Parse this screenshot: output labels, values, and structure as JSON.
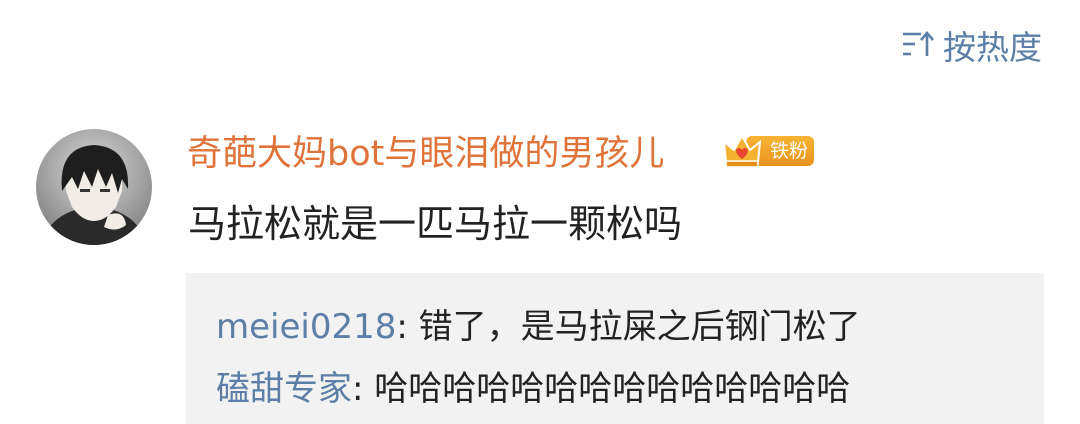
{
  "sort": {
    "label": "按热度",
    "icon": "sort-icon",
    "color": "#5b7fa6"
  },
  "comment": {
    "avatar_icon": "avatar",
    "username": "奇葩大妈bot与眼泪做的男孩儿",
    "username_color": "#e0733a",
    "badge": {
      "icon": "crown-icon",
      "label": "铁粉",
      "color": "#f0a52a"
    },
    "text": "马拉松就是一匹马拉一颗松吗"
  },
  "replies": [
    {
      "name": "meiei0218",
      "separator": ": ",
      "text": "错了，是马拉屎之后钢门松了"
    },
    {
      "name": "磕甜专家",
      "separator": ": ",
      "text": "哈哈哈哈哈哈哈哈哈哈哈哈哈哈"
    }
  ]
}
